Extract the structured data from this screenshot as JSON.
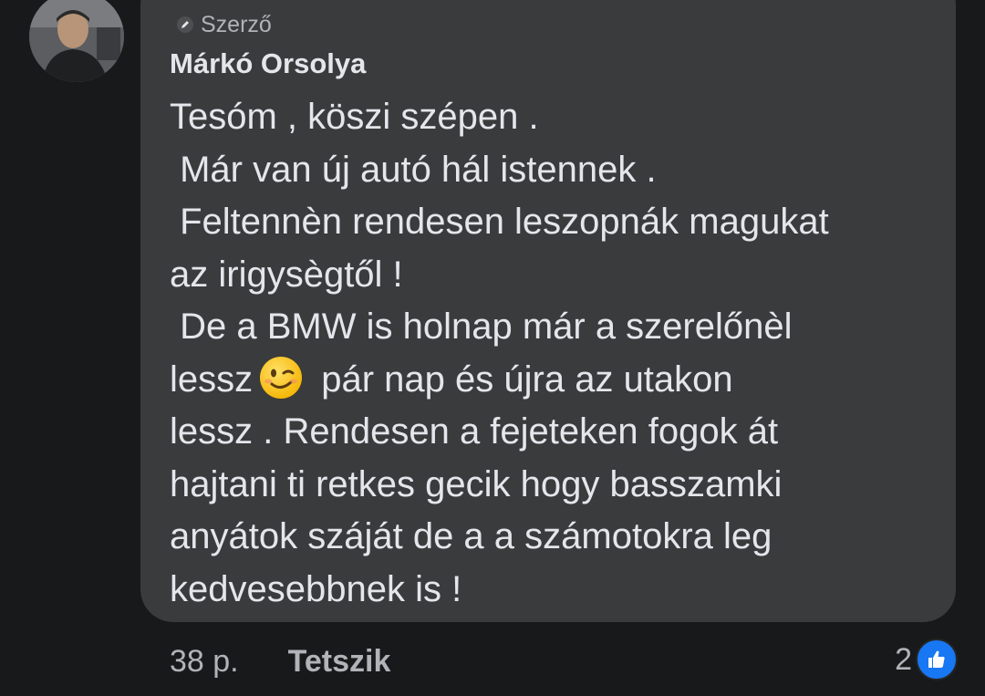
{
  "comment": {
    "author_badge": "Szerző",
    "author_name": "Márkó Orsolya",
    "lines": [
      "Tesóm , köszi szépen .",
      " Már van új autó hál istennek .",
      " Feltennèn rendesen leszopnák magukat",
      "az irigysègtől !",
      " De a BMW is holnap már a szerelőnèl",
      "lessz",
      " pár nap és újra az utakon",
      "lessz . Rendesen a fejeteken fogok át",
      "hajtani ti retkes gecik hogy basszamki",
      "anyátok száját de a a számotokra leg",
      "kedvesebbnek is !"
    ],
    "emoji": "winking-face"
  },
  "footer": {
    "time": "38 p.",
    "like_label": "Tetszik",
    "reaction_count": "2"
  },
  "colors": {
    "background": "#18191a",
    "bubble": "#3a3b3c",
    "text": "#e4e6eb",
    "secondary_text": "#b0b3b8",
    "like_blue": "#1877f2"
  }
}
